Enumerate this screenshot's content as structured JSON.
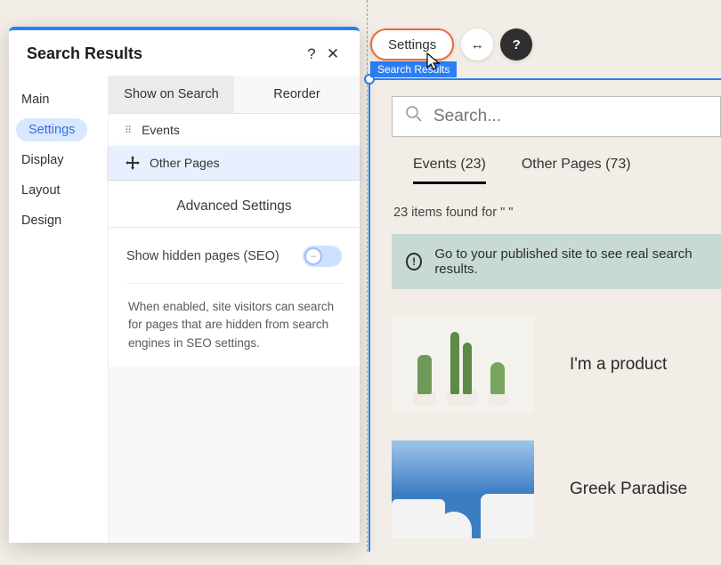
{
  "panel": {
    "title": "Search Results",
    "help_tooltip": "?",
    "close_tooltip": "✕",
    "sidebar": [
      "Main",
      "Settings",
      "Display",
      "Layout",
      "Design"
    ],
    "sidebar_active_index": 1,
    "tabs": {
      "show": "Show on Search",
      "reorder": "Reorder",
      "active": "show"
    },
    "list": [
      {
        "label": "Events",
        "dragging": false
      },
      {
        "label": "Other Pages",
        "dragging": true
      }
    ],
    "advanced": {
      "heading": "Advanced Settings",
      "toggle_label": "Show hidden pages (SEO)",
      "toggle_on": false,
      "description": "When enabled, site visitors can search for pages that are hidden from search engines in SEO settings."
    }
  },
  "floating": {
    "settings_label": "Settings",
    "stretch_icon": "↔",
    "help_icon": "?",
    "selection_label": "Search Results"
  },
  "preview": {
    "search_placeholder": "Search...",
    "tabs": [
      {
        "label": "Events (23)",
        "active": true
      },
      {
        "label": "Other Pages (73)",
        "active": false
      }
    ],
    "count_text": "23 items found for \" \"",
    "notice": "Go to your published site to see real search results.",
    "results": [
      {
        "title": "I'm a product",
        "thumb": "cactus"
      },
      {
        "title": "Greek Paradise",
        "thumb": "santorini"
      }
    ]
  }
}
